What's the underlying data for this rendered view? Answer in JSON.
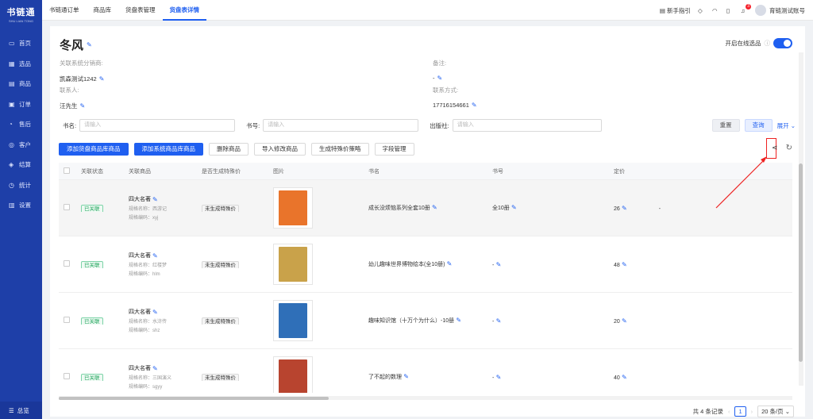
{
  "app": {
    "logo_title": "书链通",
    "logo_sub": "SHU LIAN TONG"
  },
  "sidebar": {
    "items": [
      {
        "label": "首页",
        "icon": "monitor-icon"
      },
      {
        "label": "选品",
        "icon": "grid-icon"
      },
      {
        "label": "商品",
        "icon": "box-icon"
      },
      {
        "label": "订单",
        "icon": "order-icon"
      },
      {
        "label": "售后",
        "icon": "service-icon"
      },
      {
        "label": "客户",
        "icon": "user-icon"
      },
      {
        "label": "结算",
        "icon": "settle-icon"
      },
      {
        "label": "统计",
        "icon": "chart-icon"
      },
      {
        "label": "设置",
        "icon": "gear-icon"
      }
    ],
    "bottom": "总览"
  },
  "tabs": [
    "书链通订单",
    "商品库",
    "货盘表管理",
    "货盘表详情"
  ],
  "topright": {
    "guide": "新手指引",
    "badge": "3",
    "account": "育链测试账号"
  },
  "page": {
    "title": "冬风",
    "online_label": "开启在线选品",
    "related_label": "关联系统分销商:",
    "related_value": "凯森测试1242",
    "contact_label": "联系人:",
    "contact_value": "汪先生",
    "remark_label": "备注:",
    "remark_value": "-",
    "phone_label": "联系方式:",
    "phone_value": "17716154661"
  },
  "search": {
    "book_label": "书名:",
    "book_ph": "请输入",
    "isbn_label": "书号:",
    "isbn_ph": "请输入",
    "pub_label": "出版社:",
    "pub_ph": "请输入",
    "reset": "重置",
    "query": "查询",
    "expand": "展开"
  },
  "actions": [
    "添加货盘商品库商品",
    "添加系统商品库商品",
    "删除商品",
    "导入修改商品",
    "生成特殊价策略",
    "字段管理"
  ],
  "table": {
    "headers": [
      "关联状态",
      "关联商品",
      "是否生成特殊价",
      "图片",
      "书名",
      "书号",
      "定价"
    ],
    "rows": [
      {
        "status": "已关联",
        "prod": "四大名著",
        "spec": "规格名称：西游记",
        "code": "规格编码：xyj",
        "special": "未生成特殊价",
        "title": "成长没烦恼系列全套10册",
        "isbn": "全10册",
        "price": "26",
        "extra": "-",
        "color": "#e9742b"
      },
      {
        "status": "已关联",
        "prod": "四大名著",
        "spec": "规格名称：红楼梦",
        "code": "规格编码：hlm",
        "special": "未生成特殊价",
        "title": "幼儿趣味世界博物绘本(全10册)",
        "isbn": "-",
        "price": "48",
        "extra": "",
        "color": "#c9a24a"
      },
      {
        "status": "已关联",
        "prod": "四大名著",
        "spec": "规格名称：水浒传",
        "code": "规格编码：shz",
        "special": "未生成特殊价",
        "title": "趣味知识馆（十万个为什么）-10册",
        "isbn": "-",
        "price": "20",
        "extra": "",
        "color": "#2f6fb8"
      },
      {
        "status": "已关联",
        "prod": "四大名著",
        "spec": "规格名称：三国演义",
        "code": "规格编码：sgyy",
        "special": "未生成特殊价",
        "title": "了不起的数理",
        "isbn": "-",
        "price": "40",
        "extra": "",
        "color": "#b8442f"
      }
    ]
  },
  "pager": {
    "total": "共 4 条记录",
    "page": "1",
    "size": "20 条/页"
  }
}
